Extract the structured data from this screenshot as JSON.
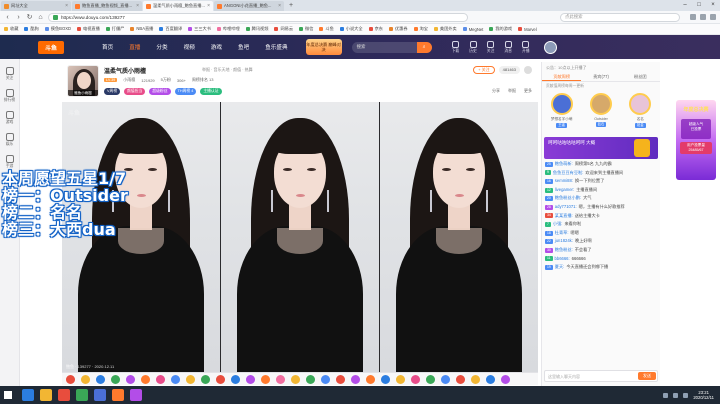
{
  "browser": {
    "tabs": [
      {
        "label": "网址大全",
        "color": "#f08c2a",
        "active": false
      },
      {
        "label": "鲍鱼直播_鲍鱼视频_直播...",
        "color": "#ff7a2d",
        "active": false
      },
      {
        "label": "温柔气质小雨檀_鲍鱼直播...",
        "color": "#ff7a2d",
        "active": true
      },
      {
        "label": "ANGONI小花直播_鲍鱼...",
        "color": "#ff7a2d",
        "active": false
      }
    ],
    "url": "https://www.douyu.com/139277",
    "search_placeholder": "点此搜索",
    "bookmarks": [
      {
        "label": "收藏",
        "color": "#f2b633"
      },
      {
        "label": "酷狗",
        "color": "#2b7de0"
      },
      {
        "label": "摸鱼BOXD",
        "color": "#5b8de8"
      },
      {
        "label": "电视直播",
        "color": "#e84d3d"
      },
      {
        "label": "打僵尸",
        "color": "#3aa757"
      },
      {
        "label": "NBA直播",
        "color": "#e8842b"
      },
      {
        "label": "百度翻译",
        "color": "#2b7de0"
      },
      {
        "label": "三三大书",
        "color": "#b34de8"
      },
      {
        "label": "哔哩哔哩",
        "color": "#f26fa0"
      },
      {
        "label": "腾讯视频",
        "color": "#3aa757"
      },
      {
        "label": "网易云",
        "color": "#e84d3d"
      },
      {
        "label": "微信",
        "color": "#3aa757"
      },
      {
        "label": "斗鱼",
        "color": "#ff7a2d"
      },
      {
        "label": "小说大全",
        "color": "#2b7de0"
      },
      {
        "label": "京东",
        "color": "#e84d3d"
      },
      {
        "label": "优惠券",
        "color": "#e8842b"
      },
      {
        "label": "淘宝",
        "color": "#ff7a2d"
      },
      {
        "label": "美团外卖",
        "color": "#f2b633"
      },
      {
        "label": "MegNet",
        "color": "#5b8de8"
      },
      {
        "label": "我的游戏",
        "color": "#3aa757"
      },
      {
        "label": "Marvel",
        "color": "#e84d3d"
      }
    ]
  },
  "site": {
    "logo": "斗鱼",
    "nav": [
      "首页",
      "直播",
      "分类",
      "视频",
      "游戏",
      "鱼吧",
      "鱼乐盛典"
    ],
    "active_nav": 1,
    "promo": "年度总决赛 巅峰对决",
    "search_placeholder": "搜索",
    "header_icons": [
      "下载",
      "历史",
      "关注",
      "消息",
      "开播"
    ]
  },
  "left_sidebar": [
    "关注",
    "排行榜",
    "游戏",
    "娱乐",
    "手游"
  ],
  "room": {
    "avatar_tag": "鲍鱼小雨檀",
    "title": "温柔气质小雨檀",
    "category": "举报 · 音乐天地 · 颜值 · 热舞",
    "level": "LV.39",
    "anchor_name": "小雨檀",
    "room_id": "121929",
    "fans": "5万粉",
    "heat": "306+",
    "rank": "周榜排名 13",
    "tags": [
      {
        "label": "V周榜",
        "color": "#2b3a67"
      },
      {
        "label": "颜值担当",
        "color": "#e84d8a"
      },
      {
        "label": "超级粉丝",
        "color": "#b34de8"
      },
      {
        "label": "TH周榜 4",
        "color": "#4b8bf5"
      },
      {
        "label": "主播认证",
        "color": "#2bbd7e"
      }
    ],
    "follow_label": "+ 关注",
    "follow_count": "481463",
    "actions": [
      "分享",
      "举报",
      "更多"
    ]
  },
  "overlay": {
    "line1": "本周愿望五星1/7",
    "line2": "榜一：Outsider",
    "line3": "榜二：名名",
    "line4": "榜三：大西dua"
  },
  "video": {
    "watermark": "斗鱼",
    "footer": "鲍鱼 · 139277 · 2020.12.11"
  },
  "gifts": [
    "#e84d3d",
    "#f2b633",
    "#2b7de0",
    "#3aa757",
    "#b34de8",
    "#ff7a2d",
    "#e84d8a",
    "#4b8bf5",
    "#f2b633",
    "#3aa757",
    "#e84d3d",
    "#2b7de0",
    "#b34de8",
    "#ff7a2d",
    "#f26fa0",
    "#f2b633",
    "#3aa757",
    "#4b8bf5",
    "#e84d3d",
    "#b34de8",
    "#ff7a2d",
    "#2b7de0",
    "#f2b633",
    "#e84d8a",
    "#3aa757",
    "#4b8bf5",
    "#e84d3d",
    "#f2b633",
    "#2b7de0",
    "#b34de8"
  ],
  "chat": {
    "top_note": "公告：10点以上开播了",
    "tabs": [
      "贡献周榜",
      "贵宾(77)",
      "粉丝团"
    ],
    "rank_note": "贡献值周榜每周一更新",
    "rank_users": [
      {
        "name": "梦想名字小萌",
        "badge": "王者",
        "color": "#4b6fd6"
      },
      {
        "name": "Outsider",
        "badge": "钻石",
        "color": "#d6a96a"
      },
      {
        "name": "名名",
        "badge": "铂金",
        "color": "#e8c4d8"
      }
    ],
    "banner": "呵呵咕咕咕咕呵呵 大概",
    "messages": [
      {
        "lv": "25",
        "lvcolor": "#4b8bf5",
        "nick": "鲍鱼萌新:",
        "text": "周榜第5名 九九的霸"
      },
      {
        "lv": "9",
        "lvcolor": "#2bbd7e",
        "nick": "鱼鱼豆豆有豆啦:",
        "text": "欢迎来到主播直播间"
      },
      {
        "lv": "16",
        "lvcolor": "#4b8bf5",
        "nick": "semmi88:",
        "text": "换一下到位置了"
      },
      {
        "lv": "12",
        "lvcolor": "#2bbd7e",
        "nick": "livegamer:",
        "text": "主播直播间"
      },
      {
        "lv": "20",
        "lvcolor": "#4b8bf5",
        "nick": "鲍鱼粉丝小鹏:",
        "text": "大气"
      },
      {
        "lv": "28",
        "lvcolor": "#b34de8",
        "nick": "ady771071:",
        "text": "嗯，主播有什么好歌推荐"
      },
      {
        "lv": "34",
        "lvcolor": "#e84d3d",
        "nick": "某某直播:",
        "text": "送给主播大卡"
      },
      {
        "lv": "7",
        "lvcolor": "#2bbd7e",
        "nick": "小强:",
        "text": "来看你啦"
      },
      {
        "lv": "18",
        "lvcolor": "#4b8bf5",
        "nick": "杜青草:",
        "text": "嗯嗯"
      },
      {
        "lv": "22",
        "lvcolor": "#4b8bf5",
        "nick": "jun1824k:",
        "text": "晚上好啊"
      },
      {
        "lv": "30",
        "lvcolor": "#b34de8",
        "nick": "鲍鱼粉丝:",
        "text": "不会看了"
      },
      {
        "lv": "11",
        "lvcolor": "#2bbd7e",
        "nick": "bb6666:",
        "text": "666666"
      },
      {
        "lv": "19",
        "lvcolor": "#4b8bf5",
        "nick": "夏天:",
        "text": "今天直播还会到哪下播"
      }
    ],
    "input_placeholder": "这里输入聊天内容",
    "send_label": "发送"
  },
  "side_promo": {
    "title": "年度总决赛",
    "card_line1": "超级人气",
    "card_line2": "已投票",
    "card2_line1": "用户投票量",
    "card2_line2": "25485/67"
  },
  "taskbar": {
    "icons": [
      "#2b7de0",
      "#f2b633",
      "#e84d3d",
      "#3aa757",
      "#4b6fd6",
      "#ff7a2d",
      "#b34de8"
    ],
    "time": "23:21",
    "date": "2020/12/11"
  }
}
